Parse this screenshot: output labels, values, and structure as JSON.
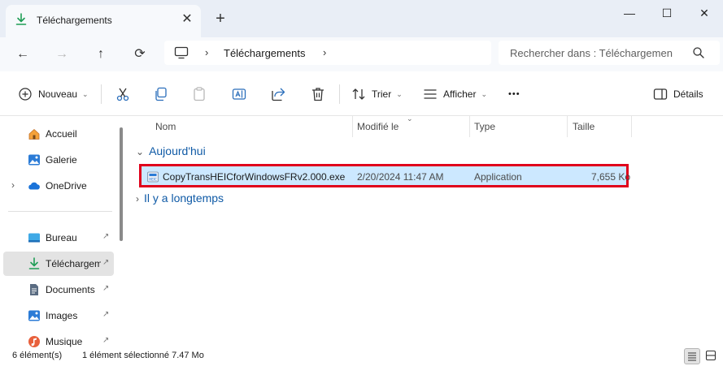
{
  "tab": {
    "title": "Téléchargements",
    "close_glyph": "✕",
    "new_tab_glyph": "+"
  },
  "window_controls": {
    "minimize": "—",
    "maximize": "☐",
    "close": "✕"
  },
  "nav": {
    "back_glyph": "←",
    "forward_glyph": "→",
    "up_glyph": "↑",
    "refresh_glyph": "⟳",
    "breadcrumb": "Téléchargements",
    "breadcrumb_chevron": "›",
    "search_placeholder": "Rechercher dans : Téléchargemen"
  },
  "commands": {
    "new": "Nouveau",
    "sort": "Trier",
    "view": "Afficher",
    "more": "•••",
    "details": "Détails",
    "dropdown_glyph": "⌄"
  },
  "sidebar": {
    "items": [
      {
        "label": "Accueil",
        "icon": "home-icon"
      },
      {
        "label": "Galerie",
        "icon": "gallery-icon"
      },
      {
        "label": "OneDrive",
        "icon": "onedrive-icon"
      },
      {
        "label": "Bureau",
        "icon": "desktop-icon"
      },
      {
        "label": "Téléchargem",
        "icon": "download-icon"
      },
      {
        "label": "Documents",
        "icon": "documents-icon"
      },
      {
        "label": "Images",
        "icon": "images-icon"
      },
      {
        "label": "Musique",
        "icon": "music-icon"
      }
    ],
    "pin_glyph": "📌",
    "expand_glyph": "›"
  },
  "columns": {
    "name": "Nom",
    "modified": "Modifié le",
    "type": "Type",
    "size": "Taille"
  },
  "groups": {
    "today": "Aujourd'hui",
    "long_ago": "Il y a longtemps",
    "expanded_glyph": "⌄",
    "collapsed_glyph": "›"
  },
  "file": {
    "name": "CopyTransHEICforWindowsFRv2.000.exe",
    "modified": "2/20/2024 11:47 AM",
    "type": "Application",
    "size": "7,655 Ko"
  },
  "status": {
    "count": "6 élément(s)",
    "selection": "1 élément sélectionné  7.47 Mo"
  },
  "colors": {
    "accent": "#0f5aa6",
    "selection": "#cce8ff",
    "highlight_border": "#e0001b",
    "download_green": "#1f9d55"
  }
}
